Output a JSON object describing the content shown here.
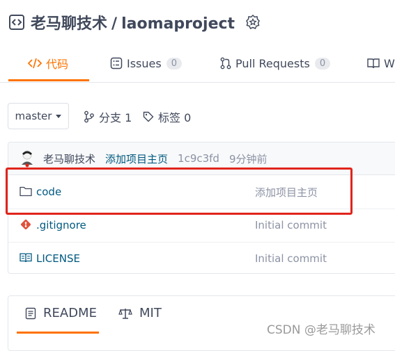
{
  "repo": {
    "owner": "老马聊技术",
    "separator": "/",
    "name": "laomaproject"
  },
  "tabs": [
    {
      "label": "代码",
      "active": true
    },
    {
      "label": "Issues",
      "count": "0"
    },
    {
      "label": "Pull Requests",
      "count": "0"
    },
    {
      "label": "W"
    }
  ],
  "branch": {
    "selected": "master"
  },
  "branch_count": "分支 1",
  "tag_count": "标签 0",
  "latest_commit": {
    "author": "老马聊技术",
    "message": "添加项目主页",
    "hash": "1c9c3fd",
    "time": "9分钟前"
  },
  "files": [
    {
      "name": "code",
      "type": "folder",
      "commit": "添加项目主页"
    },
    {
      "name": ".gitignore",
      "type": "git-file",
      "commit": "Initial commit"
    },
    {
      "name": "LICENSE",
      "type": "license",
      "commit": "Initial commit"
    }
  ],
  "readme_tabs": [
    {
      "label": "README",
      "active": true
    },
    {
      "label": "MIT"
    }
  ],
  "watermark": "CSDN @老马聊技术",
  "colors": {
    "accent": "#fe7300",
    "link": "#005980",
    "highlight": "#e0241b"
  }
}
